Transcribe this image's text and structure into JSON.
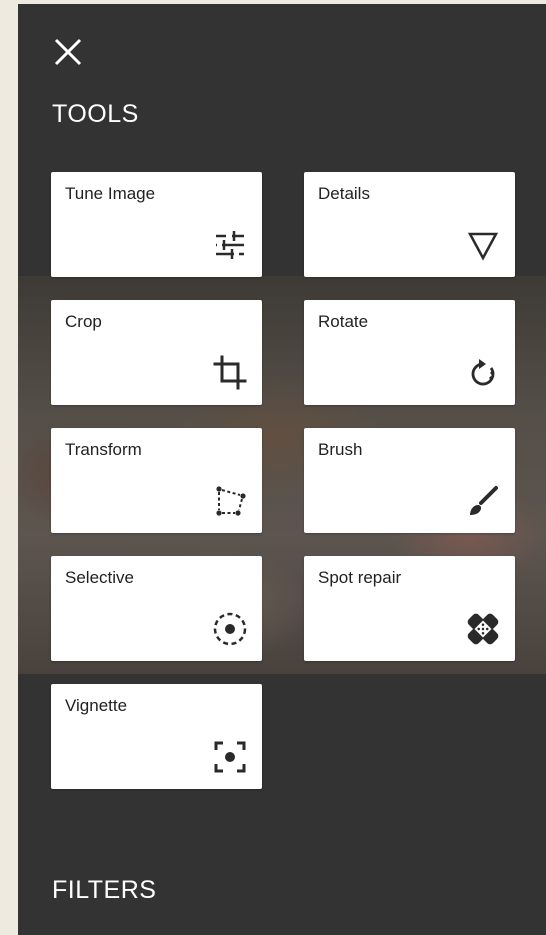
{
  "panel": {
    "close_icon": "close-icon",
    "tools_heading": "TOOLS",
    "filters_heading": "FILTERS"
  },
  "tools": [
    {
      "label": "Tune Image",
      "icon": "tune-sliders-icon"
    },
    {
      "label": "Details",
      "icon": "details-triangle-icon"
    },
    {
      "label": "Crop",
      "icon": "crop-icon"
    },
    {
      "label": "Rotate",
      "icon": "rotate-icon"
    },
    {
      "label": "Transform",
      "icon": "transform-icon"
    },
    {
      "label": "Brush",
      "icon": "brush-icon"
    },
    {
      "label": "Selective",
      "icon": "selective-icon"
    },
    {
      "label": "Spot repair",
      "icon": "spot-repair-icon"
    },
    {
      "label": "Vignette",
      "icon": "vignette-icon"
    }
  ],
  "colors": {
    "panel_background": "#333333",
    "card_background": "#ffffff",
    "icon_color": "#2a2a2a",
    "heading_color": "#ffffff"
  }
}
